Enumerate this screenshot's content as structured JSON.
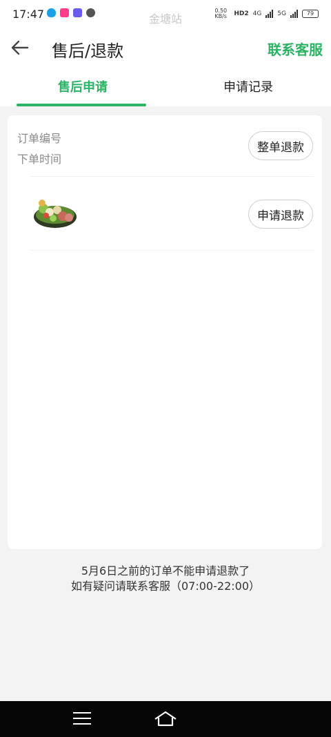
{
  "status_bar": {
    "time": "17:47",
    "station": "金塘站",
    "net_speed": "0.50 KB/s",
    "hd_label": "HD2",
    "net1": "4G",
    "net2": "5G",
    "battery": "79",
    "app_icons": [
      "qq-icon",
      "pink-app-icon",
      "photo-app-icon",
      "circle-app-icon"
    ]
  },
  "header": {
    "title": "售后/退款",
    "contact": "联系客服",
    "back_icon": "arrow-left-icon"
  },
  "tabs": [
    {
      "label": "售后申请",
      "active": true
    },
    {
      "label": "申请记录",
      "active": false
    }
  ],
  "order": {
    "number_label": "订单编号",
    "time_label": "下单时间",
    "full_refund_button": "整单退款",
    "item_refund_button": "申请退款",
    "product_icon": "salad-platter-image"
  },
  "notice": {
    "line1": "5月6日之前的订单不能申请退款了",
    "line2": "如有疑问请联系客服（07:00-22:00）"
  },
  "colors": {
    "accent": "#2bb364",
    "background": "#f3f3f3"
  },
  "nav": {
    "menu_icon": "menu-icon",
    "home_icon": "home-icon"
  }
}
